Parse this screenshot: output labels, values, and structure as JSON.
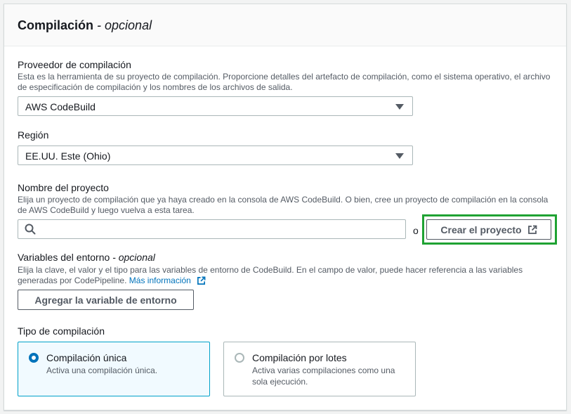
{
  "panel": {
    "title": "Compilación",
    "title_suffix": "- opcional"
  },
  "provider": {
    "label": "Proveedor de compilación",
    "description": "Esta es la herramienta de su proyecto de compilación. Proporcione detalles del artefacto de compilación, como el sistema operativo, el archivo de especificación de compilación y los nombres de los archivos de salida.",
    "value": "AWS CodeBuild"
  },
  "region": {
    "label": "Región",
    "value": "EE.UU. Este (Ohio)"
  },
  "project": {
    "label": "Nombre del proyecto",
    "description": "Elija un proyecto de compilación que ya haya creado en la consola de AWS CodeBuild. O bien, cree un proyecto de compilación en la consola de AWS CodeBuild y luego vuelva a esta tarea.",
    "search_value": "",
    "or_text": "o",
    "create_button": "Crear el proyecto"
  },
  "env_vars": {
    "label": "Variables del entorno",
    "label_suffix": "- opcional",
    "description": "Elija la clave, el valor y el tipo para las variables de entorno de CodeBuild. En el campo de valor, puede hacer referencia a las variables generadas por CodePipeline.",
    "more_info_link": "Más información",
    "add_button": "Agregar la variable de entorno"
  },
  "build_type": {
    "label": "Tipo de compilación",
    "options": [
      {
        "title": "Compilación única",
        "description": "Activa una compilación única.",
        "selected": true
      },
      {
        "title": "Compilación por lotes",
        "description": "Activa varias compilaciones como una sola ejecución.",
        "selected": false
      }
    ]
  },
  "colors": {
    "highlight": "#1fa233",
    "link": "#0073bb",
    "selected_border": "#00a1c9"
  }
}
